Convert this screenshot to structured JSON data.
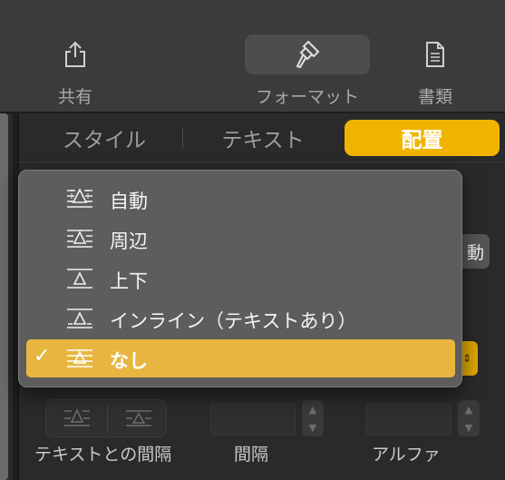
{
  "toolbar": {
    "share": {
      "label": "共有",
      "icon": "share-icon"
    },
    "format": {
      "label": "フォーマット",
      "icon": "paintbrush-icon",
      "active": true
    },
    "document": {
      "label": "書類",
      "icon": "document-icon"
    }
  },
  "tabs": [
    {
      "label": "スタイル",
      "selected": false
    },
    {
      "label": "テキスト",
      "selected": false
    },
    {
      "label": "配置",
      "selected": true
    }
  ],
  "obscured": {
    "button_partial_label": "動"
  },
  "wrap_menu": {
    "selected_index": 4,
    "items": [
      {
        "label": "自動",
        "icon": "wrap-automatic-icon"
      },
      {
        "label": "周辺",
        "icon": "wrap-around-icon"
      },
      {
        "label": "上下",
        "icon": "wrap-above-below-icon"
      },
      {
        "label": "インライン（テキストあり）",
        "icon": "wrap-inline-icon"
      },
      {
        "label": "なし",
        "icon": "wrap-none-icon"
      }
    ],
    "check_glyph": "✓"
  },
  "bottom": {
    "text_fit_label": "テキストとの間隔",
    "spacing_label": "間隔",
    "alpha_label": "アルファ"
  },
  "colors": {
    "accent": "#f0b400",
    "menu_selection": "#e8b640",
    "toolbar_bg": "#3b3b3b",
    "panel_bg": "#2a2a2a",
    "menu_bg": "#5d5d5d"
  }
}
